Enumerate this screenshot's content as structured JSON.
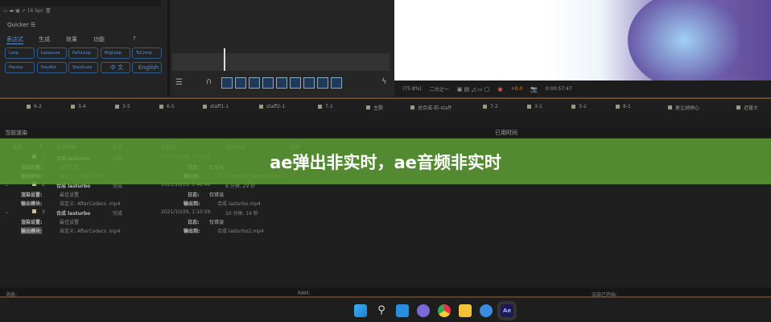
{
  "quicker": {
    "title": "Quicker",
    "bpc": "16 bpc",
    "tabs": [
      "表达式",
      "生成",
      "效果",
      "功能",
      "?"
    ],
    "buttons": [
      "Loop",
      "Loopause",
      "PathLoop",
      "WigLoop",
      "ToComp",
      "Hanley",
      "StayRot",
      "StayScale",
      "中 文",
      "English"
    ]
  },
  "viewer": {
    "zoom": "(75.8%)",
    "resolution": "二分之一",
    "exposure": "+0.0",
    "timecode": "0:00:57:47"
  },
  "comp_tabs": [
    "6-2",
    "3-4",
    "3-5",
    "6-5",
    "staff1-1",
    "staff2-1",
    "7-1",
    "主歌",
    "总合成-前-staff",
    "7-2",
    "3-1",
    "3-2",
    "8-1",
    "更让她倾心",
    "迟援大"
  ],
  "render_queue": {
    "current_render": "当前渲染",
    "elapsed_label": "已用时间",
    "columns": [
      "渲染",
      "#",
      "合成名称",
      "状态",
      "已启动",
      "渲染时间",
      "注释"
    ],
    "items": [
      {
        "num": "1",
        "comp": "合成 lasturbo",
        "status": "完成",
        "started": "2021/10/29, 0:20:11",
        "time": "",
        "render_settings": "最佳设置",
        "log": "仅错误",
        "output_module": "自定义: \"PNG\" 序列",
        "output_to": "合成 lasturbo_[####].png"
      },
      {
        "num": "2",
        "comp": "合成 lasturbo",
        "status": "完成",
        "started": "2021/10/29, 0:48:48",
        "time": "8 分钟, 29 秒",
        "render_settings": "最佳设置",
        "log": "仅错误",
        "output_module": "自定义: AfterCodecs .mp4",
        "output_to": "合成 lasturbo.mp4"
      },
      {
        "num": "3",
        "comp": "合成 lasturbo",
        "status": "完成",
        "started": "2021/10/29, 1:10:59",
        "time": "10 分钟, 19 秒",
        "render_settings": "最佳设置",
        "log": "仅错误",
        "output_module": "自定义: AfterCodecs .mp4",
        "output_to": "合成 lasturbo2.mp4"
      }
    ],
    "labels": {
      "render_settings": "渲染设置:",
      "output_module": "输出模块:",
      "log": "日志:",
      "output_to": "输出到:"
    }
  },
  "banner": {
    "text": "ae弹出非实时，ae音频非实时"
  },
  "status": {
    "message": "消息:",
    "ram": "RAM:",
    "render_started": "渲染已开始:"
  },
  "taskbar": {
    "apps": [
      "windows-start",
      "search",
      "widgets",
      "teams-chat",
      "chrome",
      "file-explorer",
      "phone-link",
      "after-effects"
    ],
    "ae_label": "Ae"
  }
}
